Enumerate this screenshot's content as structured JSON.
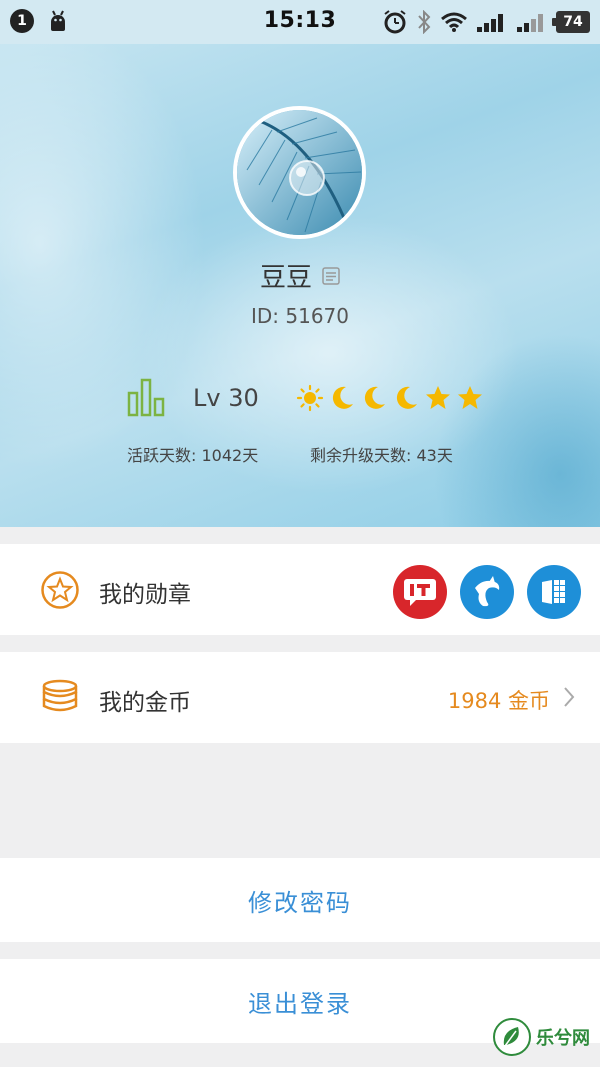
{
  "status_bar": {
    "notification_count": "1",
    "time": "15:13",
    "battery": "74",
    "icons": [
      "android-icon",
      "alarm-icon",
      "bluetooth-icon",
      "wifi-icon",
      "signal-icon",
      "signal-icon"
    ]
  },
  "profile": {
    "username": "豆豆",
    "user_id": "ID: 51670",
    "level": "Lv 30",
    "level_badges": [
      "sun-icon",
      "moon-icon",
      "moon-icon",
      "moon-icon",
      "star-icon",
      "star-icon"
    ],
    "active_days": "活跃天数: 1042天",
    "remaining_days": "剩余升级天数: 43天"
  },
  "badges": {
    "label": "我的勋章",
    "items": [
      {
        "name": "it-badge",
        "text": "IT",
        "color": "#d8262b"
      },
      {
        "name": "dolphin-badge",
        "color": "#1e8fd8"
      },
      {
        "name": "windows-badge",
        "color": "#1e8fd8"
      }
    ]
  },
  "coins": {
    "label": "我的金币",
    "value": "1984 金币"
  },
  "actions": {
    "change_password": "修改密码",
    "logout": "退出登录"
  },
  "watermark": {
    "text": "乐兮网"
  },
  "colors": {
    "accent_orange": "#e58a1f",
    "action_blue": "#3a8fd6",
    "level_green": "#7cb342",
    "badge_yellow": "#f5b800"
  }
}
